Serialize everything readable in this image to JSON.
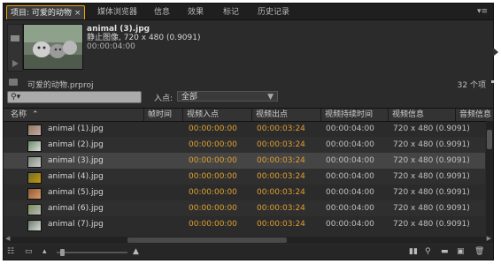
{
  "tabs": [
    {
      "label": "项目: 可爱的动物",
      "close": "×"
    },
    {
      "label": "媒体浏览器"
    },
    {
      "label": "信息"
    },
    {
      "label": "效果"
    },
    {
      "label": "标记"
    },
    {
      "label": "历史记录"
    }
  ],
  "panel_menu_icon": "panel-menu-icon",
  "preview": {
    "filename": "animal (3).jpg",
    "line2": "静止图像, 720 x 480 (0.9091)",
    "duration": "00:00:04:00"
  },
  "project": {
    "name": "可爱的动物.prproj",
    "count": "32 个项"
  },
  "search": {
    "icon": "search-icon",
    "placeholder": ""
  },
  "in_point": {
    "label": "入点:",
    "value": "全部"
  },
  "columns": [
    "名称",
    "帧时间",
    "视频入点",
    "视频出点",
    "视频持续时间",
    "视频信息",
    "音频信息"
  ],
  "rows": [
    {
      "name": "animal (1).jpg",
      "in": "00:00:00:00",
      "out": "00:00:03:24",
      "dur": "00:00:04:00",
      "info": "720 x 480 (0.9091)"
    },
    {
      "name": "animal (2).jpg",
      "in": "00:00:00:00",
      "out": "00:00:03:24",
      "dur": "00:00:04:00",
      "info": "720 x 480 (0.9091)"
    },
    {
      "name": "animal (3).jpg",
      "in": "00:00:00:00",
      "out": "00:00:03:24",
      "dur": "00:00:04:00",
      "info": "720 x 480 (0.9091)"
    },
    {
      "name": "animal (4).jpg",
      "in": "00:00:00:00",
      "out": "00:00:03:24",
      "dur": "00:00:04:00",
      "info": "720 x 480 (0.9091)"
    },
    {
      "name": "animal (5).jpg",
      "in": "00:00:00:00",
      "out": "00:00:03:24",
      "dur": "00:00:04:00",
      "info": "720 x 480 (0.9091)"
    },
    {
      "name": "animal (6).jpg",
      "in": "00:00:00:00",
      "out": "00:00:03:24",
      "dur": "00:00:04:00",
      "info": "720 x 480 (0.9091)"
    },
    {
      "name": "animal (7).jpg",
      "in": "00:00:00:00",
      "out": "00:00:03:24",
      "dur": "00:00:04:00",
      "info": "720 x 480 (0.9091)"
    }
  ],
  "selected_row": 2,
  "colors": {
    "timecode": "#e0a030",
    "active_tab_border": "#f0a000",
    "panel_bg": "#2b2b2b"
  }
}
